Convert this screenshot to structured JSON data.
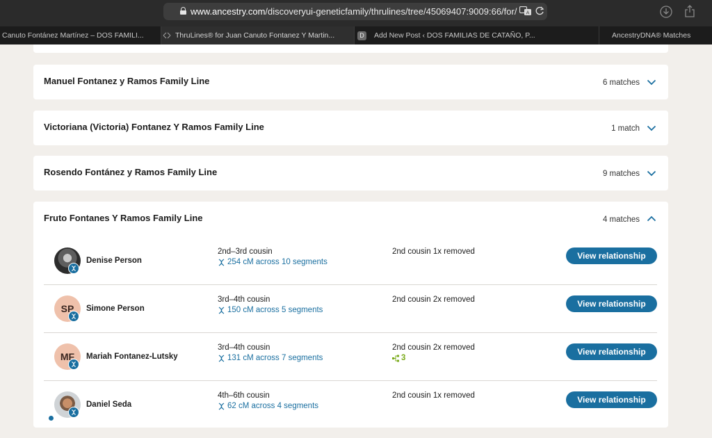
{
  "browser": {
    "url_host": "www.ancestry.com",
    "url_path": "/discoveryui-geneticfamily/thrulines/tree/45069407:9009:66/for/0",
    "tabs": [
      {
        "label": "Canuto Fontánez Martínez – DOS FAMILI..."
      },
      {
        "label": "ThruLines® for Juan Canuto Fontanez Y Martin..."
      },
      {
        "label": "Add New Post ‹ DOS FAMILIAS DE CATAÑO, P...",
        "favicon_letter": "D"
      },
      {
        "label": "AncestryDNA® Matches"
      }
    ]
  },
  "family_lines": [
    {
      "title": "Manuel Fontanez y Ramos Family Line",
      "matches": "6 matches",
      "expanded": false
    },
    {
      "title": "Victoriana (Victoria) Fontanez Y Ramos Family Line",
      "matches": "1 match",
      "expanded": false
    },
    {
      "title": "Rosendo Fontánez y Ramos Family Line",
      "matches": "9 matches",
      "expanded": false
    },
    {
      "title": "Fruto Fontanes Y Ramos Family Line",
      "matches": "4 matches",
      "expanded": true
    }
  ],
  "matches": [
    {
      "name": "Denise Person",
      "initials": "",
      "relationship": "2nd–3rd cousin",
      "shared_dna": "254 cM across 10 segments",
      "path": "2nd cousin 1x removed",
      "tree_count": "",
      "button": "View relationship"
    },
    {
      "name": "Simone Person",
      "initials": "SP",
      "relationship": "3rd–4th cousin",
      "shared_dna": "150 cM across 5 segments",
      "path": "2nd cousin 2x removed",
      "tree_count": "",
      "button": "View relationship"
    },
    {
      "name": "Mariah Fontanez-Lutsky",
      "initials": "MF",
      "relationship": "3rd–4th cousin",
      "shared_dna": "131 cM across 7 segments",
      "path": "2nd cousin 2x removed",
      "tree_count": "3",
      "button": "View relationship"
    },
    {
      "name": "Daniel Seda",
      "initials": "",
      "relationship": "4th–6th cousin",
      "shared_dna": "62 cM across 4 segments",
      "path": "2nd cousin 1x removed",
      "tree_count": "",
      "button": "View relationship"
    }
  ],
  "colors": {
    "accent": "#1a6fa0",
    "tree_green": "#7bab1c",
    "avatar_bg": "#efc1ab"
  }
}
